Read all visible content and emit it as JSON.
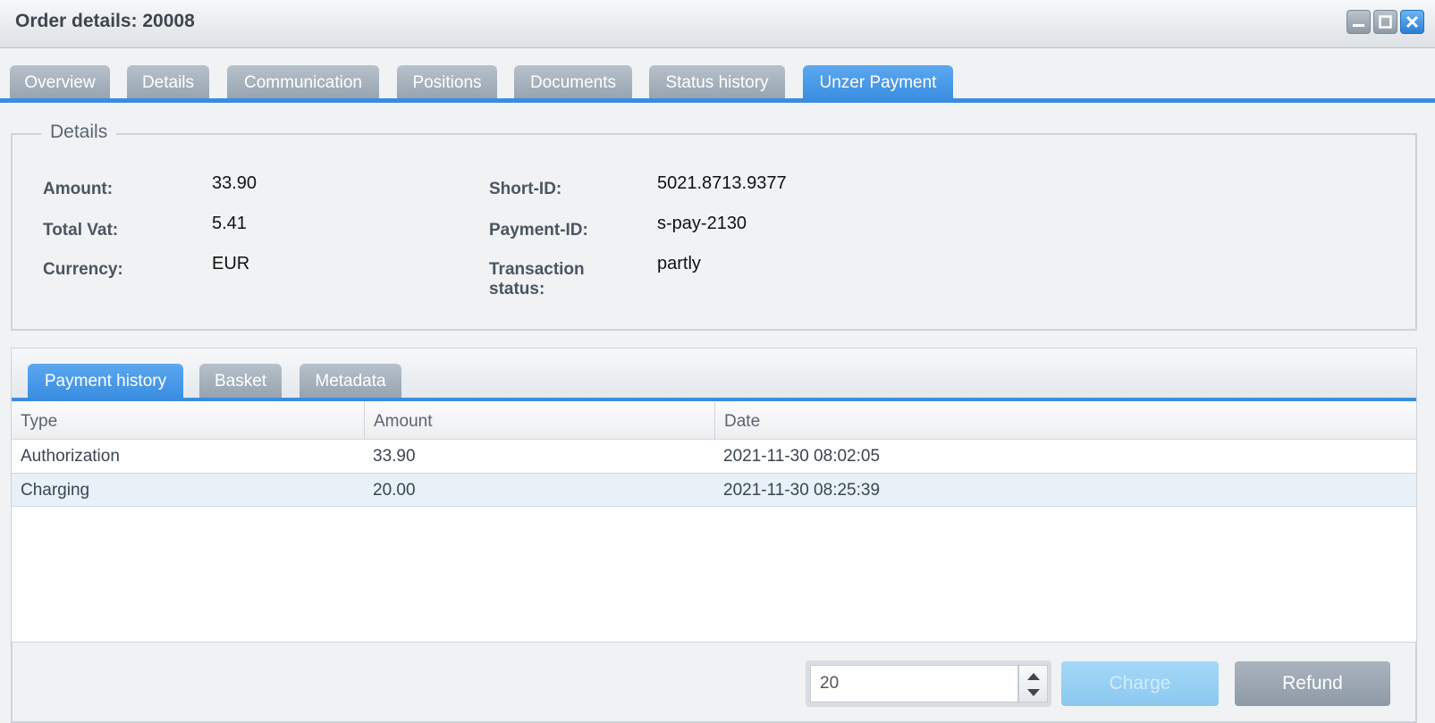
{
  "window": {
    "title": "Order details: 20008"
  },
  "tabs": [
    {
      "label": "Overview"
    },
    {
      "label": "Details"
    },
    {
      "label": "Communication"
    },
    {
      "label": "Positions"
    },
    {
      "label": "Documents"
    },
    {
      "label": "Status history"
    },
    {
      "label": "Unzer Payment",
      "active": true
    }
  ],
  "details": {
    "legend": "Details",
    "amount_label": "Amount:",
    "amount": "33.90",
    "total_vat_label": "Total Vat:",
    "total_vat": "5.41",
    "currency_label": "Currency:",
    "currency": "EUR",
    "short_id_label": "Short-ID:",
    "short_id": "5021.8713.9377",
    "payment_id_label": "Payment-ID:",
    "payment_id": "s-pay-2130",
    "transaction_status_label_line1": "Transaction",
    "transaction_status_label_line2": "status:",
    "transaction_status": "partly"
  },
  "subtabs": [
    {
      "label": "Payment history",
      "active": true
    },
    {
      "label": "Basket"
    },
    {
      "label": "Metadata"
    }
  ],
  "history": {
    "columns": [
      "Type",
      "Amount",
      "Date"
    ],
    "rows": [
      {
        "type": "Authorization",
        "amount": "33.90",
        "date": "2021-11-30 08:02:05",
        "selected": false
      },
      {
        "type": "Charging",
        "amount": "20.00",
        "date": "2021-11-30 08:25:39",
        "selected": true
      }
    ]
  },
  "actions": {
    "amount_value": "20",
    "charge_label": "Charge",
    "refund_label": "Refund"
  },
  "colors": {
    "accent": "#3a8de0",
    "tab_inactive": "#a5b0bb"
  }
}
